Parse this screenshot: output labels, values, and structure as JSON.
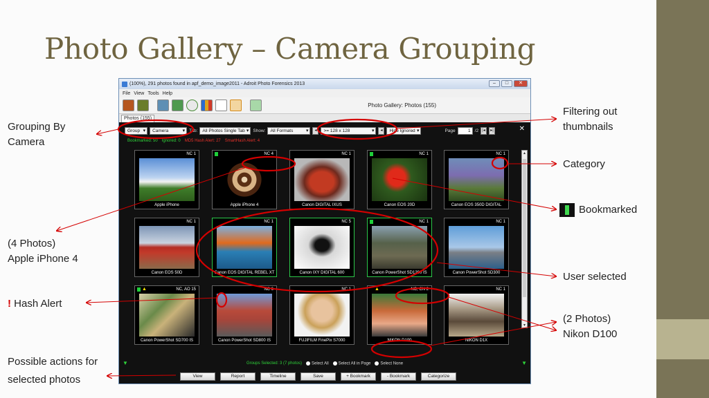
{
  "slide": {
    "title": "Photo Gallery – Camera Grouping",
    "colors": {
      "title": "#6f6440",
      "accent_bar": "#7a7457",
      "annotation": "#d40000"
    }
  },
  "callouts": {
    "grouping": [
      "Grouping By",
      "Camera"
    ],
    "filtering": [
      "Filtering out",
      "thumbnails"
    ],
    "category": "Category",
    "bookmarked": "Bookmarked",
    "iphone4": [
      "(4 Photos)",
      "Apple iPhone 4"
    ],
    "hash_alert_mark": "!",
    "hash_alert": "Hash Alert",
    "user_selected": "User selected",
    "nikon": [
      "(2 Photos)",
      "Nikon D100"
    ],
    "actions": [
      "Possible actions for",
      "selected photos"
    ]
  },
  "window": {
    "title": "(100%), 291 photos found in apf_demo_image2011 - Adroit Photo Forensics 2013",
    "menu": [
      "File",
      "View",
      "Tools",
      "Help"
    ],
    "toolbar_title": "Photo Gallery: Photos (155)",
    "tab": "Photos (155)",
    "filter": {
      "group": "Group",
      "camera": "Camera",
      "tab_label": "Tab:",
      "tab_value": "All Photos Single Tab",
      "show_label": "Show:",
      "show_value": "All Formats",
      "size_value": ">= 128 x 128",
      "ignored_value": "Hide Ignored",
      "page_label": "Page",
      "page_value": "1",
      "page_total": "/2"
    },
    "alerts": {
      "bookmarked": "Bookmarked: 50",
      "ignored": "Ignored: 0",
      "md5": "MD5 Hash Alert: 27",
      "smart": "SmartHash Alert: 4"
    },
    "thumbnails": [
      {
        "caption": "Apple iPhone",
        "badge": "NC 1",
        "flag": false,
        "alert": false,
        "selected": false
      },
      {
        "caption": "Apple iPhone 4",
        "badge": "NC 4",
        "flag": true,
        "alert": false,
        "selected": false
      },
      {
        "caption": "Canon DIGITAL IXUS",
        "badge": "NC 1",
        "flag": false,
        "alert": false,
        "selected": false
      },
      {
        "caption": "Canon EOS 20D",
        "badge": "NC 1",
        "flag": true,
        "alert": false,
        "selected": false
      },
      {
        "caption": "Canon EOS 350D DIGITAL",
        "badge": "NC 1",
        "flag": false,
        "alert": false,
        "selected": false
      },
      {
        "caption": "Canon EOS 50D",
        "badge": "NC 1",
        "flag": false,
        "alert": false,
        "selected": false
      },
      {
        "caption": "Canon EOS DIGITAL REBEL XT",
        "badge": "NC 1",
        "flag": false,
        "alert": false,
        "selected": true
      },
      {
        "caption": "Canon IXY DIGITAL 600",
        "badge": "NC 5",
        "flag": false,
        "alert": false,
        "selected": true
      },
      {
        "caption": "Canon PowerShot SD1200 IS",
        "badge": "NC 1",
        "flag": true,
        "alert": false,
        "selected": true
      },
      {
        "caption": "Canon PowerShot SD300",
        "badge": "NC 1",
        "flag": false,
        "alert": false,
        "selected": false
      },
      {
        "caption": "Canon PowerShot SD700 IS",
        "badge": "NC, AO  15",
        "flag": true,
        "alert": true,
        "selected": false
      },
      {
        "caption": "Canon PowerShot SD800 IS",
        "badge": "NC 6",
        "flag": false,
        "alert": false,
        "selected": false
      },
      {
        "caption": "FUJIFILM FinePix S7000",
        "badge": "NC 1",
        "flag": false,
        "alert": false,
        "selected": false
      },
      {
        "caption": "NIKON D100",
        "badge": "NC, CN  2",
        "flag": false,
        "alert": true,
        "selected": false
      },
      {
        "caption": "NIKON D1X",
        "badge": "NC 1",
        "flag": false,
        "alert": false,
        "selected": false
      }
    ],
    "status": {
      "groups": "Groups Selected: 3 (7 photos)",
      "select_all": "Select All",
      "select_page": "Select All in Page",
      "select_none": "Select None"
    },
    "actions": [
      "View",
      "Report",
      "Timeline",
      "Save",
      "+ Bookmark",
      "- Bookmark",
      "Categorize"
    ]
  }
}
